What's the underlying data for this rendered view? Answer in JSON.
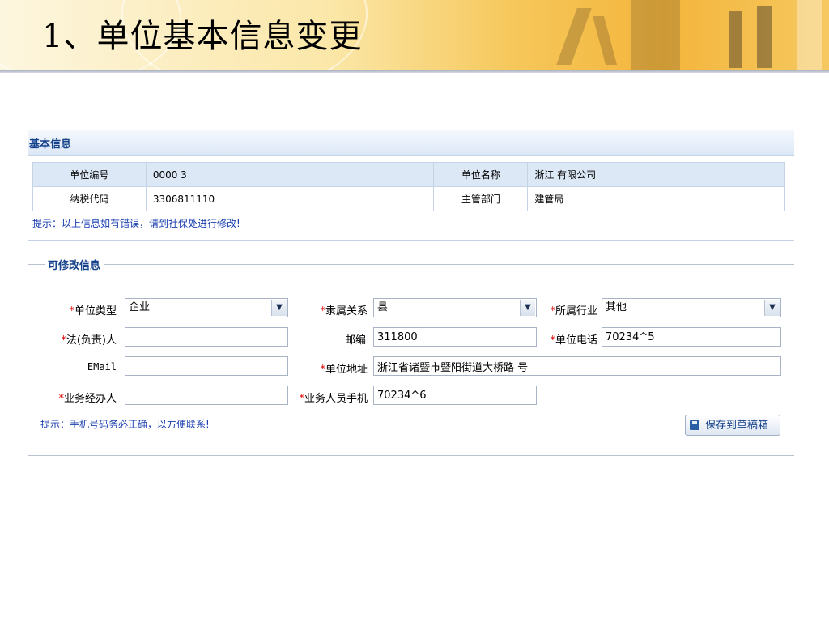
{
  "slide": {
    "title": "1、单位基本信息变更"
  },
  "basic_info": {
    "header": "基本信息",
    "rows": [
      [
        {
          "label": "单位编号",
          "value": "0000 3"
        },
        {
          "label": "单位名称",
          "value": "浙江 有限公司"
        }
      ],
      [
        {
          "label": "纳税代码",
          "value": "3306811110"
        },
        {
          "label": "主管部门",
          "value": "建管局"
        }
      ]
    ],
    "hint": "提示：以上信息如有错误，请到社保处进行修改!"
  },
  "editable": {
    "legend": "可修改信息",
    "required_mark": "*",
    "fields": {
      "unit_type": {
        "label": "单位类型",
        "value": "企业"
      },
      "affiliation": {
        "label": "隶属关系",
        "value": "县"
      },
      "industry": {
        "label": "所属行业",
        "value": "其他"
      },
      "legal_rep": {
        "label": "法(负责)人",
        "value": ""
      },
      "postcode": {
        "label": "邮编",
        "value": "311800"
      },
      "unit_phone": {
        "label": "单位电话",
        "value": "70234^5"
      },
      "email": {
        "label": "EMail",
        "value": ""
      },
      "address": {
        "label": "单位地址",
        "value": "浙江省诸暨市暨阳街道大桥路 号"
      },
      "handler": {
        "label": "业务经办人",
        "value": "  "
      },
      "handler_mobile": {
        "label": "业务人员手机",
        "value": "70234^6"
      }
    },
    "hint": "提示：手机号码务必正确，以方便联系!",
    "save_label": "保存到草稿箱"
  },
  "icons": {
    "dropdown": "chevron-down-icon",
    "save": "floppy-disk-icon"
  },
  "colors": {
    "header_text": "#15428b",
    "required": "#e00000",
    "hint_text": "#1a3fb0"
  }
}
